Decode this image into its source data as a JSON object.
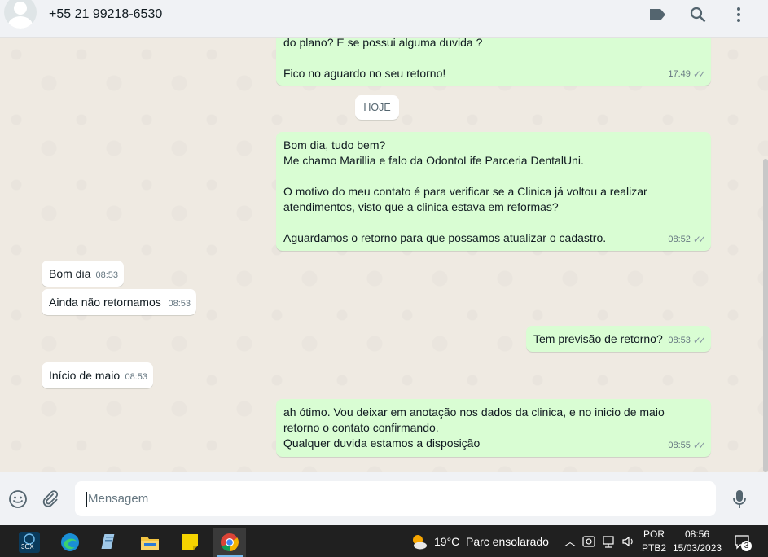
{
  "header": {
    "contact_name": "+55 21 99218-6530",
    "icons": [
      "avatar",
      "label-icon",
      "search-icon",
      "menu-icon"
    ]
  },
  "chat": {
    "messages": [
      {
        "direction": "out",
        "text": "do plano? E se possui alguma duvida ?\n\nFico no aguardo no seu retorno!",
        "time": "17:49"
      },
      {
        "direction": "out",
        "text": "Bom dia, tudo bem?\nMe chamo Marillia e falo da OdontoLife Parceria DentalUni.\n\nO motivo do meu contato é para verificar se a Clinica já voltou a realizar\natendimentos, visto que a clinica estava em reformas?\n\nAguardamos o retorno para que possamos atualizar o cadastro.",
        "time": "08:52"
      },
      {
        "direction": "in",
        "text": "Bom dia",
        "time": "08:53"
      },
      {
        "direction": "in",
        "text": "Ainda não retornamos",
        "time": "08:53"
      },
      {
        "direction": "out",
        "text": "Tem previsão de retorno?",
        "time": "08:53"
      },
      {
        "direction": "in",
        "text": "Início de maio",
        "time": "08:53"
      },
      {
        "direction": "out",
        "text": "ah ótimo. Vou deixar em anotação nos dados da clinica, e no inicio de maio\nretorno o contato confirmando.\nQualquer duvida estamos a disposição",
        "time": "08:55"
      }
    ],
    "day_divider": "HOJE"
  },
  "composer": {
    "placeholder": "Mensagem",
    "value": ""
  },
  "taskbar": {
    "apps": [
      "3cx-icon",
      "edge-icon",
      "notepad-icon",
      "file-explorer-icon",
      "sticky-notes-icon",
      "chrome-icon"
    ],
    "app_3cx_label": "3CX",
    "weather_temp": "19°C",
    "weather_desc": "Parc ensolarado",
    "lang_top": "POR",
    "lang_bottom": "PTB2",
    "time": "08:56",
    "date": "15/03/2023",
    "notifications": "3"
  },
  "colors": {
    "outgoing_bubble": "#d9fdd3",
    "incoming_bubble": "#ffffff",
    "chat_bg": "#efeae2",
    "header_bg": "#f0f2f5",
    "taskbar_bg": "#202020"
  }
}
